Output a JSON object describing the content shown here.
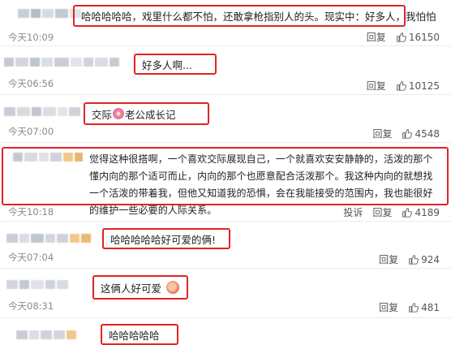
{
  "ui": {
    "reply_label": "回复",
    "report_label": "投诉"
  },
  "comments": [
    {
      "text": "哈哈哈哈哈，戏里什么都不怕，还敢拿枪指别人的头。现实中：好多人，我怕怕",
      "time": "今天10:09",
      "likes": "16150"
    },
    {
      "text": "好多人啊...",
      "time": "今天06:56",
      "likes": "10125"
    },
    {
      "text_before": "交际",
      "emoji": "flower-icon",
      "text_after": "老公成长记",
      "time": "今天07:00",
      "likes": "4548"
    },
    {
      "text": "觉得这种很搭啊，一个喜欢交际展现自己，一个就喜欢安安静静的，活泼的那个懂内向的那个适可而止，内向的那个也愿意配合活泼那个。我这种内向的就想找一个活泼的带着我，但他又知道我的恐惧，会在我能接受的范围内，我也能很好的维护一些必要的人际关系。",
      "time": "今天10:18",
      "likes": "4189"
    },
    {
      "text": "哈哈哈哈哈好可爱的俩!",
      "time": "今天07:04",
      "likes": "924"
    },
    {
      "text": "这俩人好可爱",
      "emoji": "blush-face-icon",
      "time": "今天08:31",
      "likes": "481"
    },
    {
      "text": "哈哈哈哈哈"
    }
  ]
}
